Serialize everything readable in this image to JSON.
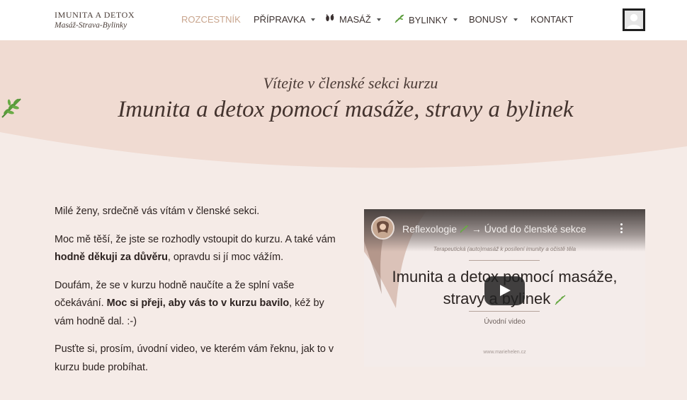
{
  "brand": {
    "name": "IMUNITA A DETOX",
    "tagline": "Masáž-Strava-Bylinky"
  },
  "nav": [
    {
      "label": "ROZCESTNÍK",
      "active": true,
      "dropdown": false,
      "icon": ""
    },
    {
      "label": "PŘÍPRAVKA",
      "active": false,
      "dropdown": true,
      "icon": ""
    },
    {
      "label": "MASÁŽ",
      "active": false,
      "dropdown": true,
      "icon": "footprints-icon"
    },
    {
      "label": "BYLINKY",
      "active": false,
      "dropdown": true,
      "icon": "leaf-icon"
    },
    {
      "label": "BONUSY",
      "active": false,
      "dropdown": true,
      "icon": ""
    },
    {
      "label": "KONTAKT",
      "active": false,
      "dropdown": false,
      "icon": ""
    }
  ],
  "user": {
    "icon": "user-avatar-icon"
  },
  "hero": {
    "pretitle": "Vítejte v členské sekci kurzu",
    "title": "Imunita a detox pomocí masáže, stravy a bylinek",
    "title_icon": "leaf-icon"
  },
  "intro": {
    "p1": "Milé ženy, srdečně vás vítám v členské sekci.",
    "p2_a": "Moc mě těší, že jste se rozhodly vstoupit do kurzu. A také vám ",
    "p2_bold": "hodně děkuji za důvěru",
    "p2_b": ", opravdu si jí moc vážím.",
    "p3_a": "Doufám, že se v kurzu hodně naučíte a že splní vaše očekávání. ",
    "p3_bold": "Moc si přeji, aby vás to v kurzu bavilo",
    "p3_b": ", kéž by vám hodně dal. :-)",
    "p4": "Pusťte si, prosím, úvodní video, ve kterém vám řeknu, jak to v kurzu bude probíhat."
  },
  "video": {
    "title_a": "Reflexologie",
    "title_b": "→ Úvod do členské sekce",
    "subtitle": "Terapeutická (auto)masáž k posílení imunity a očistě těla",
    "big_line1": "Imunita a detox pomocí masáže,",
    "big_line2": "stravy a bylinek",
    "caption": "Úvodní video",
    "url": "www.mariehelen.cz"
  },
  "colors": {
    "hero_band": "#f0dbd2",
    "page_bg": "#f5ebe7",
    "accent": "#c9a58d",
    "leaf_green": "#3f7a2e"
  }
}
